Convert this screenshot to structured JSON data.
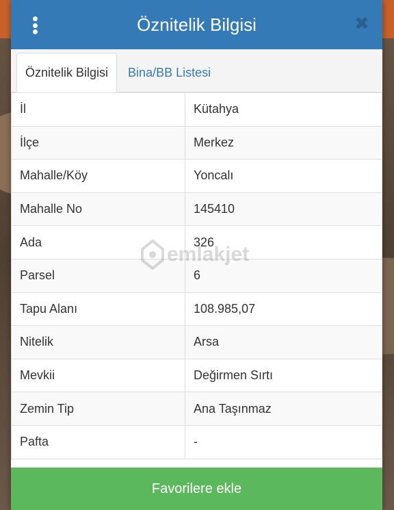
{
  "dialog": {
    "title": "Öznitelik Bilgisi",
    "close_label": "✖"
  },
  "tabs": [
    {
      "label": "Öznitelik Bilgisi",
      "active": true
    },
    {
      "label": "Bina/BB Listesi",
      "active": false
    }
  ],
  "attributes": [
    {
      "key": "İl",
      "value": "Kütahya"
    },
    {
      "key": "İlçe",
      "value": "Merkez"
    },
    {
      "key": "Mahalle/Köy",
      "value": "Yoncalı"
    },
    {
      "key": "Mahalle No",
      "value": "145410"
    },
    {
      "key": "Ada",
      "value": "326"
    },
    {
      "key": "Parsel",
      "value": "6"
    },
    {
      "key": "Tapu Alanı",
      "value": "108.985,07"
    },
    {
      "key": "Nitelik",
      "value": "Arsa"
    },
    {
      "key": "Mevkii",
      "value": "Değirmen Sırtı"
    },
    {
      "key": "Zemin Tip",
      "value": "Ana Taşınmaz"
    },
    {
      "key": "Pafta",
      "value": "-"
    }
  ],
  "watermark": {
    "text": "emlakjet"
  },
  "footer": {
    "favorite_label": "Favorilere ekle"
  },
  "colors": {
    "header": "#337ab7",
    "button": "#5cb85c"
  }
}
